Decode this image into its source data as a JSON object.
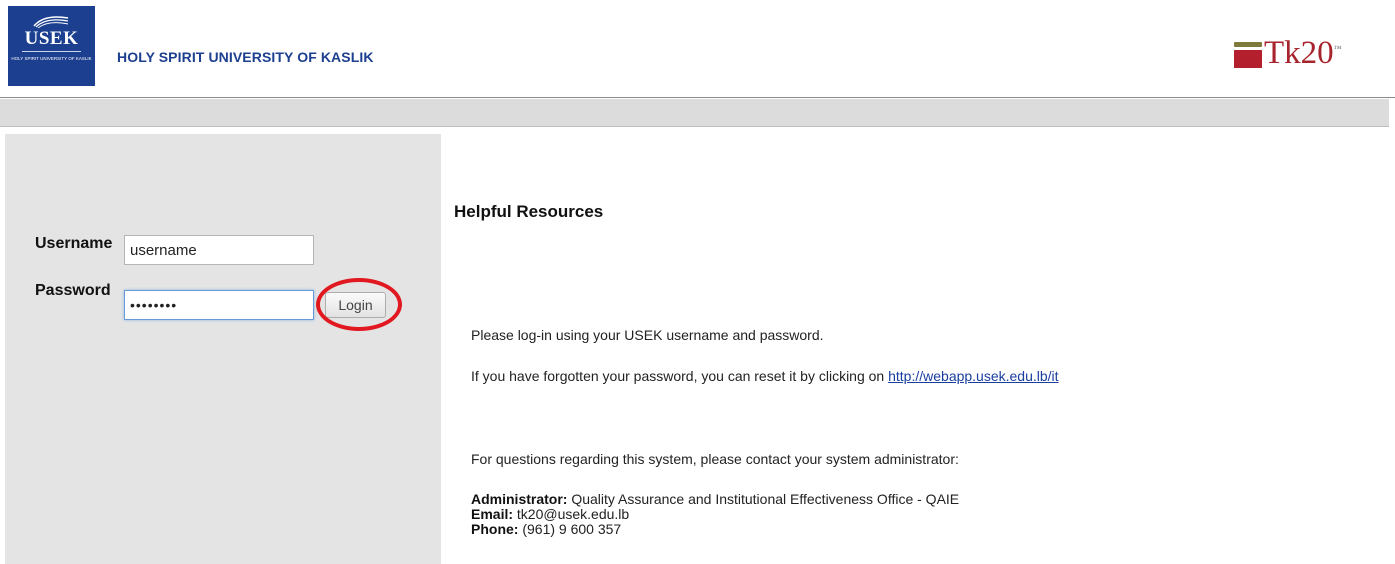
{
  "header": {
    "logo_abbr": "USEK",
    "logo_sub": "HOLY SPIRIT UNIVERSITY OF KASLIK",
    "university_name": "HOLY SPIRIT UNIVERSITY OF KASLIK",
    "tk20_wordmark": "Tk20",
    "tk20_tm": "™"
  },
  "login": {
    "username_label": "Username",
    "username_value": "username",
    "password_label": "Password",
    "password_value": "••••••••",
    "login_button": "Login"
  },
  "resources": {
    "title": "Helpful Resources",
    "login_instruction": "Please log-in using your USEK username and password.",
    "forgot_text": "If you have forgotten your password, you can reset it by clicking on ",
    "reset_link": "http://webapp.usek.edu.lb/it",
    "questions_text": "For questions regarding this system, please contact your system administrator:",
    "admin_label": "Administrator:",
    "admin_value": " Quality Assurance and Institutional Effectiveness Office - QAIE",
    "email_label": "Email:",
    "email_value": " tk20@usek.edu.lb",
    "phone_label": "Phone:",
    "phone_value": " (961) 9 600 357"
  },
  "colors": {
    "usek_blue": "#1c3f8f",
    "tk20_red": "#a8242d",
    "highlight_circle": "#e11820",
    "link": "#1a3ea0"
  }
}
